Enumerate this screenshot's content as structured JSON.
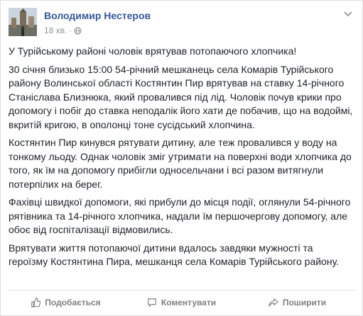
{
  "post": {
    "author": "Володимир Нестеров",
    "time": "18 хв.",
    "separator": "·",
    "privacy_icon": "globe-icon",
    "menu_icon": "chevron-down-icon",
    "paragraphs": [
      "У Турійському районі чоловік врятував потопаючого хлопчика!",
      "30 січня близько 15:00 54-річний мешканець села Комарів Турійського району Волинської області Костянтин Пир врятував на ставку 14-річного Станіслава Близнюка, який провалився під лід. Чоловік почув крики про допомогу і побіг до ставка неподалік його хати де побачив, що на водоймі, вкритій кригою, в ополонці тоне сусідський хлопчина.",
      "Костянтин Пир кинувся рятувати дитину, але теж провалився у воду на тонкому льоду. Однак чоловік зміг утримати на поверхні води хлопчика до того, як їм на допомогу прибігли односельчани і всі разом витягнули потерпілих на берег.",
      "Фахівці швидкої допомоги, які прибули до місця події, оглянули 54-річного рятівника та 14-річного хлопчика, надали їм першочергову допомогу, але обоє від госпіталізації відмовились.",
      "Врятувати життя потопаючої дитини вдалось завдяки мужності та героїзму Костянтина Пира, мешканця села Комарів Турійського району."
    ]
  },
  "actions": {
    "like": "Подобається",
    "comment": "Коментувати",
    "share": "Поширити"
  },
  "colors": {
    "link": "#365899",
    "text": "#1d2129",
    "meta": "#90949c",
    "action": "#7f7f7f"
  }
}
